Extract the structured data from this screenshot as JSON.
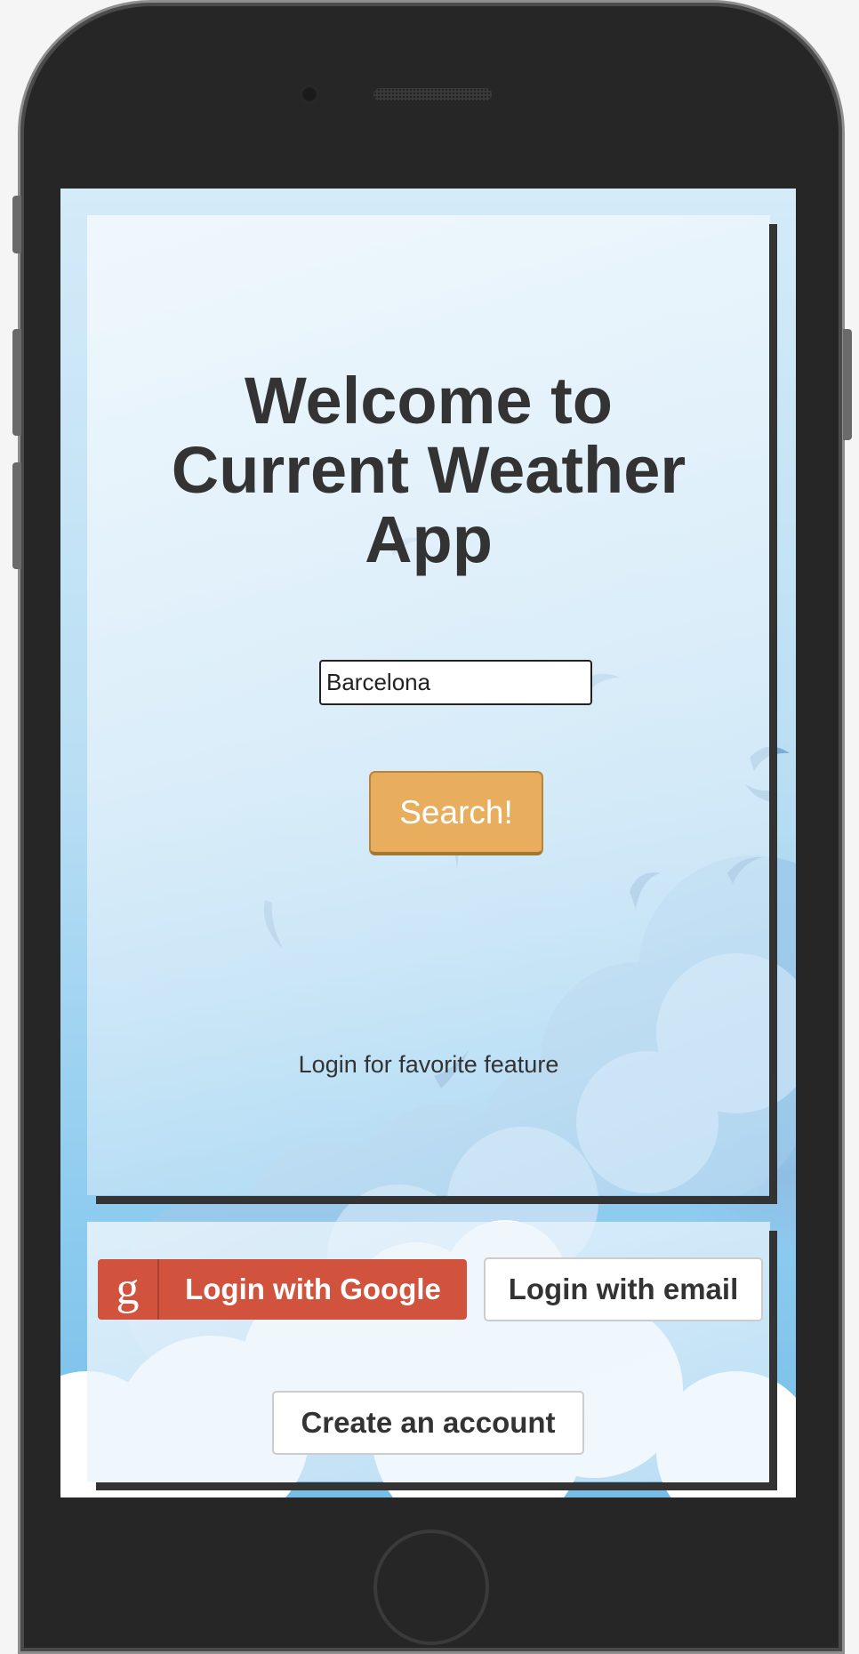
{
  "app": {
    "title": "Welcome to Current Weather App"
  },
  "search": {
    "value": "Barcelona",
    "button_label": "Search!"
  },
  "login_note": "Login for favorite feature",
  "auth": {
    "google_icon_glyph": "g",
    "google_label": "Login with Google",
    "email_label": "Login with email",
    "create_label": "Create an account"
  },
  "colors": {
    "search_button": "#e8ae5e",
    "google_button": "#d1533e",
    "text": "#333333",
    "sky": "#b9def4"
  }
}
